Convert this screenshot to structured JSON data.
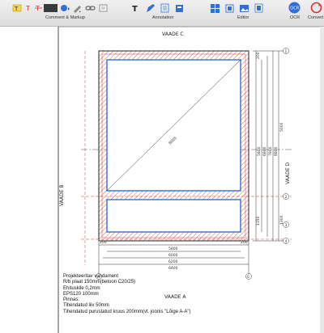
{
  "toolbar": {
    "groups": [
      {
        "label": "Comment & Markup"
      },
      {
        "label": "Annotation"
      },
      {
        "label": "Editor"
      },
      {
        "label": "OCR"
      },
      {
        "label": "Convert"
      }
    ],
    "icons": [
      "highlight-icon",
      "text-color-icon",
      "strike-icon",
      "color-swatch",
      "shape-icon",
      "pen-icon",
      "link-icon",
      "stamp-icon",
      "text-box-icon",
      "note-icon",
      "form-icon",
      "attachment-icon",
      "page-icon",
      "crop-icon",
      "image-icon",
      "watermark-icon",
      "ocr-icon",
      "convert-icon"
    ],
    "accent": "#2f6fd6"
  },
  "drawing": {
    "top_title": "VAADE C",
    "bottom_title": "VAADE A",
    "left_title": "VAADE B",
    "right_title": "VAADE D",
    "bottom_dims": [
      "5800",
      "6000",
      "6200",
      "6400"
    ],
    "bottom_small": [
      "200",
      "200"
    ],
    "right_dims_inner": [
      "5800",
      "6800",
      "7800",
      "8800"
    ],
    "right_dims_outer": [
      "5000",
      "1300"
    ],
    "right_small": [
      "200",
      "1350"
    ],
    "diagonal_label": "8005",
    "axis_markers_bottom": [
      "A",
      "E"
    ],
    "axis_markers_right": [
      "1",
      "2",
      "3",
      "4"
    ]
  },
  "notes": {
    "title": "Projekteeritav vundament",
    "lines": [
      "R/b plaat 150mm(betoon C20/25)",
      "Ehituskile 0,2mm",
      "EPS120  100mm",
      "Pinnas:",
      "Tihendatud liiv 50mm",
      "Tihendatud purustatud kruus 200mm(vt. joonis \"Lõige A-A\")"
    ]
  }
}
